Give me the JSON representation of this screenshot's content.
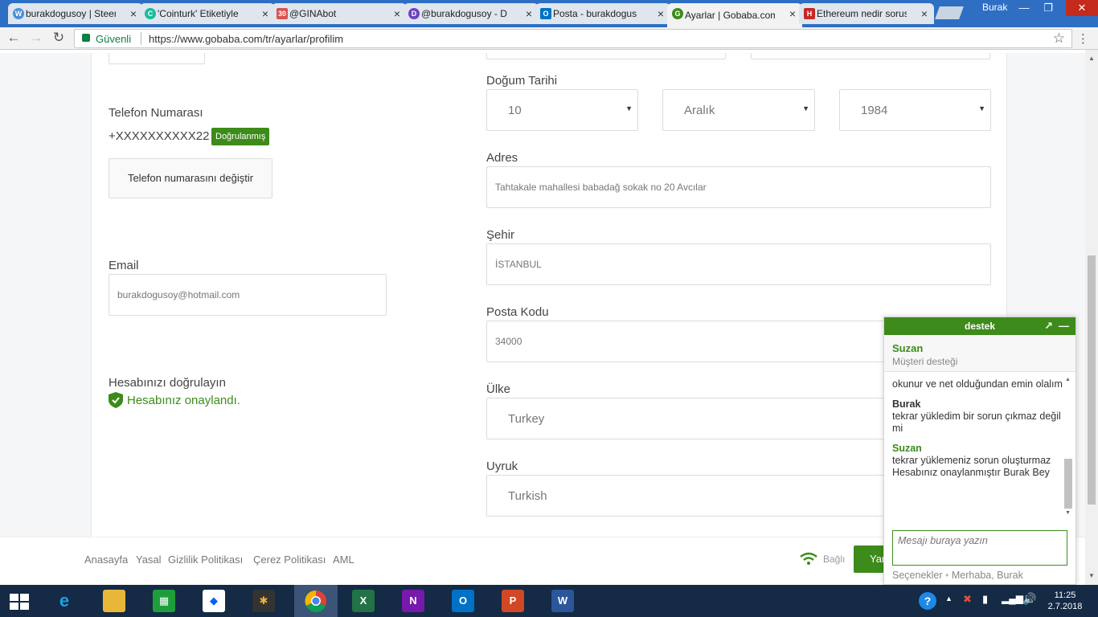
{
  "browser": {
    "tabs": [
      {
        "title": "burakdogusoy | Steemit",
        "icon_color": "#4a90d9",
        "icon": "W"
      },
      {
        "title": "'Cointurk' Etiketiyle",
        "icon_color": "#1abc9c",
        "icon": "C"
      },
      {
        "title": "@GINAbot",
        "icon_color": "#d9534f",
        "icon": "30"
      },
      {
        "title": "@burakdogusoy - D",
        "icon_color": "#6f42c1",
        "icon": "D"
      },
      {
        "title": "Posta - burakdogus",
        "icon_color": "#0072c6",
        "icon": "O"
      },
      {
        "title": "Ayarlar | Gobaba.com",
        "icon_color": "#3d8b1a",
        "icon": "G"
      },
      {
        "title": "Ethereum nedir sorusu",
        "icon_color": "#c62828",
        "icon": "H"
      }
    ],
    "user": "Burak",
    "secure_label": "Güvenli",
    "url": "https://www.gobaba.com/tr/ayarlar/profilim"
  },
  "form": {
    "phone_label": "Telefon Numarası",
    "phone_value": "+XXXXXXXXXX22",
    "verified_badge": "Doğrulanmış",
    "change_phone_button": "Telefon numarasını değiştir",
    "email_label": "Email",
    "email_value": "burakdogusoy@hotmail.com",
    "verify_label": "Hesabınızı doğrulayın",
    "verified_text": "Hesabınız onaylandı.",
    "birth_label": "Doğum Tarihi",
    "birth_day": "10",
    "birth_month": "Aralık",
    "birth_year": "1984",
    "address_label": "Adres",
    "address_value": "Tahtakale mahallesi babadağ sokak no 20 Avcılar",
    "city_label": "Şehir",
    "city_value": "İSTANBUL",
    "postal_label": "Posta Kodu",
    "postal_value": "34000",
    "country_label": "Ülke",
    "country_value": "Turkey",
    "nationality_label": "Uyruk",
    "nationality_value": "Turkish"
  },
  "footer": {
    "links": [
      "Anasayfa",
      "Yasal",
      "Gizlilik Politikası",
      "Çerez Politikası",
      "AML"
    ],
    "connection": "Bağlı",
    "help_button": "Yar"
  },
  "chat": {
    "title": "destek",
    "agent_name": "Suzan",
    "agent_role": "Müşteri desteği",
    "messages": [
      {
        "who": "",
        "text": "okunur ve net olduğundan emin olalım"
      },
      {
        "who": "Burak",
        "text": "tekrar yükledim bir sorun çıkmaz değil mi"
      },
      {
        "who": "Suzan",
        "text": "tekrar yüklemeniz sorun oluşturmaz Hesabınız onaylanmıştır Burak Bey"
      }
    ],
    "input_placeholder": "Mesajı buraya yazın",
    "options_label": "Seçenekler",
    "greeting": "Merhaba, Burak"
  },
  "taskbar": {
    "time": "11:25",
    "date": "2.7.2018"
  },
  "colors": {
    "brand_green": "#3d8b1a",
    "chrome_blue": "#2e6fc4",
    "taskbar": "#142a45"
  }
}
